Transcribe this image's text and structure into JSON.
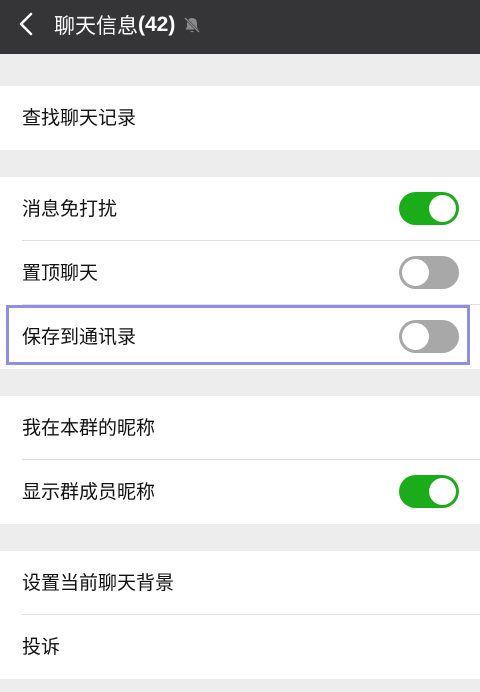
{
  "titlebar": {
    "title": "聊天信息",
    "count": "(42)",
    "back_icon": "chevron-left-icon",
    "mute_icon": "bell-muted-icon"
  },
  "settings": {
    "search_history": {
      "label": "查找聊天记录"
    },
    "mute": {
      "label": "消息免打扰",
      "on": true
    },
    "pin": {
      "label": "置顶聊天",
      "on": false
    },
    "save_contacts": {
      "label": "保存到通讯录",
      "on": false,
      "highlighted": true
    },
    "my_nickname": {
      "label": "我在本群的昵称"
    },
    "show_nicknames": {
      "label": "显示群成员昵称",
      "on": true
    },
    "background": {
      "label": "设置当前聊天背景"
    },
    "report": {
      "label": "投诉"
    }
  },
  "colors": {
    "titlebar": "#353537",
    "toggle_on": "#1aad19",
    "toggle_off": "#a8a8a8",
    "highlight": "#8e8ee6",
    "background": "#ededed"
  }
}
